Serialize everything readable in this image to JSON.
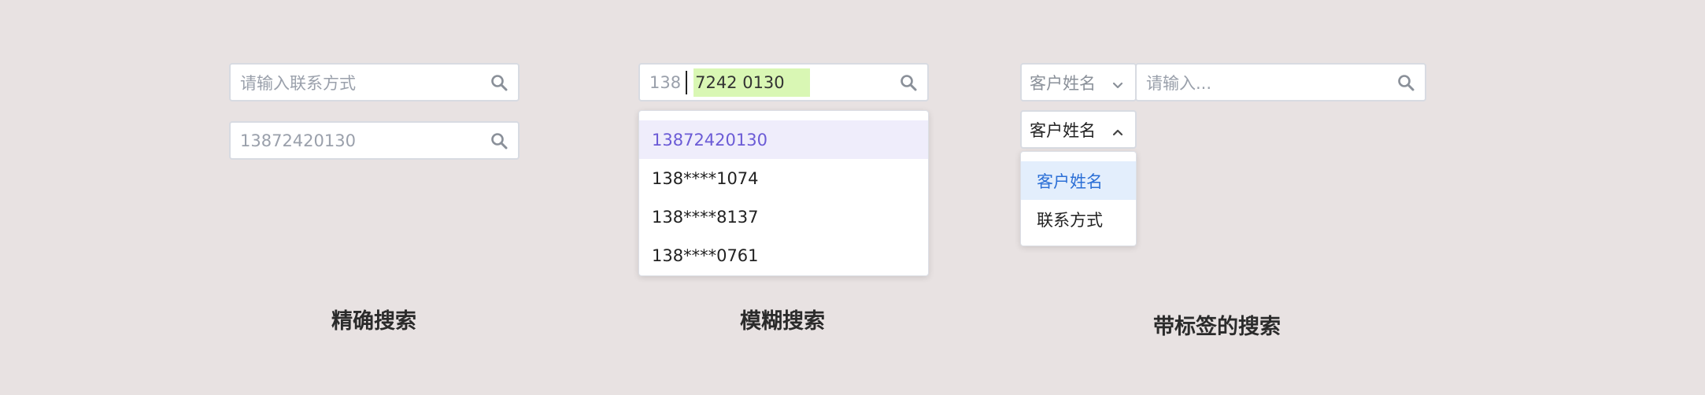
{
  "exact": {
    "placeholder": "请输入联系方式",
    "value": "13872420130",
    "caption": "精确搜索"
  },
  "fuzzy": {
    "typed": "138",
    "matched": "7242 0130",
    "options": [
      "13872420130",
      "138****1074",
      "138****8137",
      "138****0761"
    ],
    "caption": "模糊搜索"
  },
  "tagged": {
    "tag_label": "客户姓名",
    "input_placeholder": "请输入...",
    "open_tag_label": "客户姓名",
    "options": [
      "客户姓名",
      "联系方式"
    ],
    "caption": "带标签的搜索"
  },
  "colors": {
    "background": "#e8e2e2",
    "match_highlight": "#d9f7b4",
    "active_option_purple": "#6b5bd6",
    "active_option_blue": "#2b6fd6"
  },
  "icons": [
    "search-icon",
    "chevron-down-icon",
    "chevron-up-icon"
  ]
}
